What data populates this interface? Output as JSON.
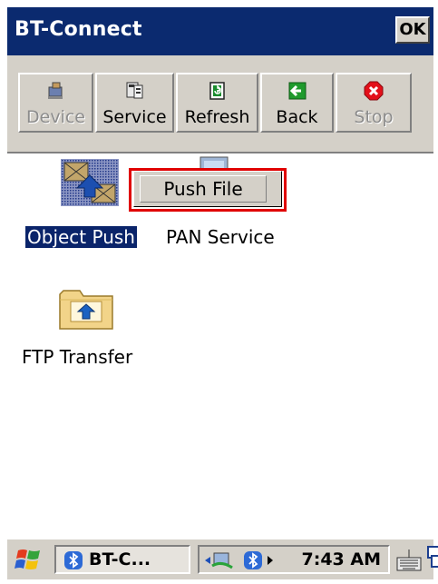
{
  "window": {
    "title": "BT-Connect",
    "ok_label": "OK"
  },
  "toolbar": {
    "buttons": [
      {
        "label": "Device",
        "icon": "device-icon",
        "enabled": false
      },
      {
        "label": "Service",
        "icon": "service-icon",
        "enabled": true
      },
      {
        "label": "Refresh",
        "icon": "refresh-icon",
        "enabled": true
      },
      {
        "label": "Back",
        "icon": "back-arrow-icon",
        "enabled": true
      },
      {
        "label": "Stop",
        "icon": "stop-icon",
        "enabled": false
      }
    ]
  },
  "services": [
    {
      "label": "Object Push",
      "icon": "object-push-icon",
      "selected": true
    },
    {
      "label": "PAN Service",
      "icon": "pan-service-icon",
      "selected": false
    },
    {
      "label": "FTP Transfer",
      "icon": "ftp-folder-icon",
      "selected": false
    }
  ],
  "context_menu": {
    "items": [
      {
        "label": "Push File"
      }
    ]
  },
  "taskbar": {
    "start_icon": "windows-flag-icon",
    "task_label": "BT-C...",
    "clock": "7:43 AM",
    "tray_icons": [
      "network-icon",
      "bluetooth-icon",
      "tray-arrow-icon"
    ],
    "keyboard_icon": "keyboard-icon",
    "windows_icon": "switch-windows-icon"
  },
  "colors": {
    "titlebar": "#0b2a6f",
    "selection": "#0a246a",
    "highlight_box": "#e00000"
  }
}
